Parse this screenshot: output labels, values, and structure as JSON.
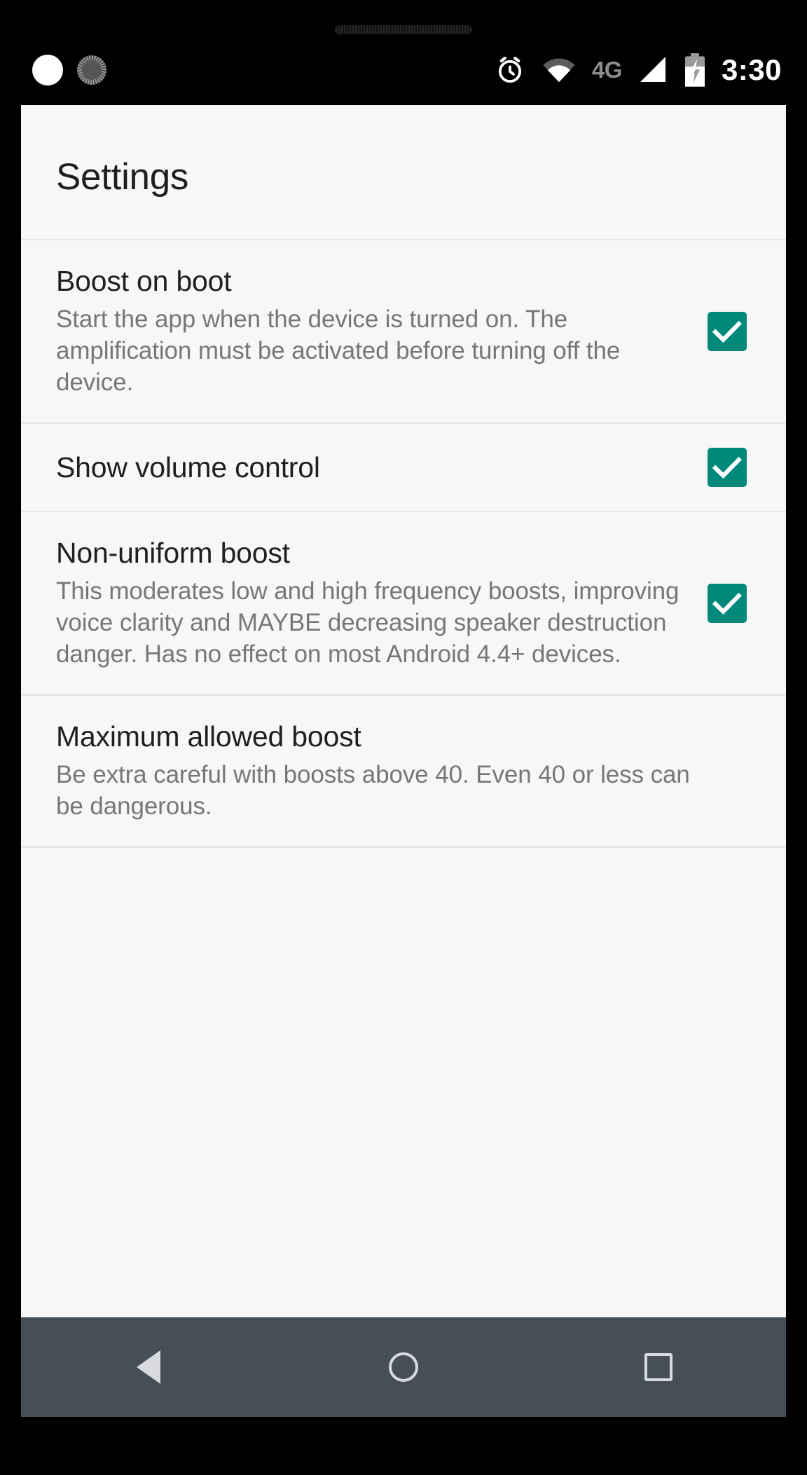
{
  "status_bar": {
    "notification_icons": [
      "circle-notification-icon",
      "gear-progress-icon"
    ],
    "alarm_icon": "alarm-clock-icon",
    "wifi_icon": "wifi-icon",
    "network_label": "4G",
    "signal_icon": "cellular-signal-icon",
    "battery_icon": "battery-charging-icon",
    "time": "3:30"
  },
  "app": {
    "title": "Settings",
    "accent_color": "#00897b",
    "background_color": "#f7f7f7"
  },
  "preferences": [
    {
      "title": "Boost on boot",
      "summary": "Start the app when the device is turned on. The amplification must be activated before turning off the device.",
      "has_checkbox": true,
      "checked": true
    },
    {
      "title": "Show volume control",
      "summary": "",
      "has_checkbox": true,
      "checked": true
    },
    {
      "title": "Non-uniform boost",
      "summary": "This moderates low and high frequency boosts, improving voice clarity and MAYBE decreasing speaker destruction danger. Has no effect on most Android 4.4+ devices.",
      "has_checkbox": true,
      "checked": true
    },
    {
      "title": "Maximum allowed boost",
      "summary": "Be extra careful with boosts above 40. Even 40 or less can be dangerous.",
      "has_checkbox": false,
      "checked": false
    }
  ],
  "navigation_bar": {
    "back_label": "back-button",
    "home_label": "home-button",
    "recents_label": "recents-button"
  }
}
